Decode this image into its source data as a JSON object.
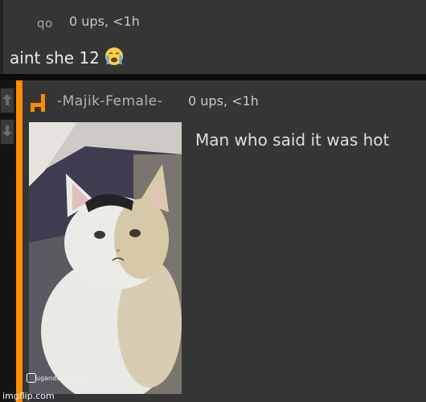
{
  "top_comment": {
    "username": "qo",
    "meta": "0 ups, <1h",
    "text": "aint she 12",
    "emoji_icon": "loudly-crying-face-icon"
  },
  "reply_comment": {
    "username": "-Majik-Female-",
    "meta": "0 ups, <1h",
    "text": "Man who said it was hot",
    "image_watermark": "ugandan_nockle",
    "accent_color": "#ff8c00"
  },
  "site_watermark": "imgflip.com",
  "vote_icons": [
    "upvote-arrow-icon",
    "downvote-arrow-icon"
  ]
}
